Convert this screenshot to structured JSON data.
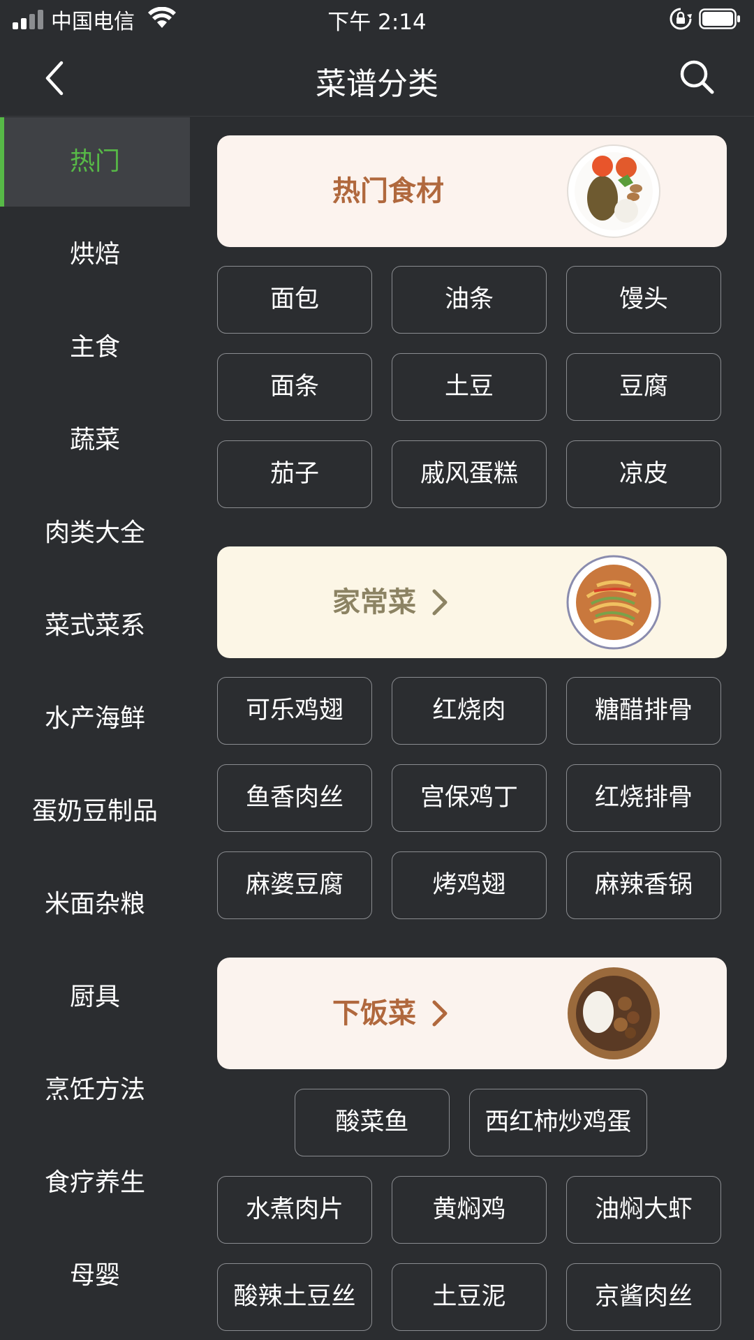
{
  "status_bar": {
    "carrier": "中国电信",
    "time": "下午 2:14"
  },
  "nav": {
    "title": "菜谱分类",
    "back_icon": "chevron-left-icon",
    "search_icon": "search-icon"
  },
  "sidebar": {
    "active_color": "#57b947",
    "items": [
      {
        "label": "热门",
        "active": true
      },
      {
        "label": "烘焙"
      },
      {
        "label": "主食"
      },
      {
        "label": "蔬菜"
      },
      {
        "label": "肉类大全"
      },
      {
        "label": "菜式菜系"
      },
      {
        "label": "水产海鲜"
      },
      {
        "label": "蛋奶豆制品"
      },
      {
        "label": "米面杂粮"
      },
      {
        "label": "厨具"
      },
      {
        "label": "烹饪方法"
      },
      {
        "label": "食疗养生"
      },
      {
        "label": "母婴"
      }
    ]
  },
  "sections": [
    {
      "banner": {
        "label": "热门食材",
        "has_arrow": false,
        "bg": "#fcf3ee",
        "text_color": "#b0683d",
        "image": "ingredients-plate-image"
      },
      "chips": [
        "面包",
        "油条",
        "馒头",
        "面条",
        "土豆",
        "豆腐",
        "茄子",
        "戚风蛋糕",
        "凉皮"
      ]
    },
    {
      "banner": {
        "label": "家常菜",
        "has_arrow": true,
        "bg": "#fcf6e6",
        "text_color": "#8c8363",
        "image": "home-dish-plate-image"
      },
      "chips": [
        "可乐鸡翅",
        "红烧肉",
        "糖醋排骨",
        "鱼香肉丝",
        "宫保鸡丁",
        "红烧排骨",
        "麻婆豆腐",
        "烤鸡翅",
        "麻辣香锅"
      ]
    },
    {
      "banner": {
        "label": "下饭菜",
        "has_arrow": true,
        "bg": "#fbf3ee",
        "text_color": "#b0683d",
        "image": "rice-dish-plate-image"
      },
      "chips_row1": [
        "酸菜鱼",
        "西红柿炒鸡蛋"
      ],
      "chips": [
        "水煮肉片",
        "黄焖鸡",
        "油焖大虾",
        "酸辣土豆丝",
        "土豆泥",
        "京酱肉丝"
      ]
    }
  ]
}
